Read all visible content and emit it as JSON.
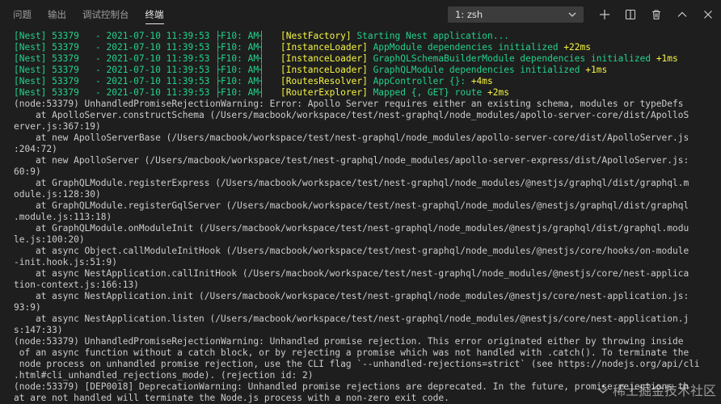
{
  "panel": {
    "tabs": [
      {
        "label": "问题"
      },
      {
        "label": "输出"
      },
      {
        "label": "调试控制台"
      },
      {
        "label": "终端"
      }
    ],
    "active_tab": "终端",
    "terminal_select": "1: zsh"
  },
  "colors": {
    "background": "#1e1e1e",
    "green": "#23d18b",
    "yellow": "#f5f543",
    "text": "#cccccc"
  },
  "icons": [
    "chevron-down-icon",
    "plus-icon",
    "split-icon",
    "trash-icon",
    "chevron-up-icon",
    "close-icon"
  ],
  "nest_logs": [
    {
      "prefix": "[Nest] 53379   - 2021-07-10 11:39:53 ├F10: AM┤   ",
      "context": "[NestFactory]",
      "message": " Starting Nest application...",
      "time": ""
    },
    {
      "prefix": "[Nest] 53379   - 2021-07-10 11:39:53 ├F10: AM┤   ",
      "context": "[InstanceLoader]",
      "message": " AppModule dependencies initialized ",
      "time": "+22ms"
    },
    {
      "prefix": "[Nest] 53379   - 2021-07-10 11:39:53 ├F10: AM┤   ",
      "context": "[InstanceLoader]",
      "message": " GraphQLSchemaBuilderModule dependencies initialized ",
      "time": "+1ms"
    },
    {
      "prefix": "[Nest] 53379   - 2021-07-10 11:39:53 ├F10: AM┤   ",
      "context": "[InstanceLoader]",
      "message": " GraphQLModule dependencies initialized ",
      "time": "+1ms"
    },
    {
      "prefix": "[Nest] 53379   - 2021-07-10 11:39:53 ├F10: AM┤   ",
      "context": "[RoutesResolver]",
      "message": " AppController {}: ",
      "time": "+4ms"
    },
    {
      "prefix": "[Nest] 53379   - 2021-07-10 11:39:53 ├F10: AM┤   ",
      "context": "[RouterExplorer]",
      "message": " Mapped {, GET} route ",
      "time": "+2ms"
    }
  ],
  "output_lines": [
    "(node:53379) UnhandledPromiseRejectionWarning: Error: Apollo Server requires either an existing schema, modules or typeDefs",
    "    at ApolloServer.constructSchema (/Users/macbook/workspace/test/nest-graphql/node_modules/apollo-server-core/dist/ApolloS",
    "erver.js:367:19)",
    "    at new ApolloServerBase (/Users/macbook/workspace/test/nest-graphql/node_modules/apollo-server-core/dist/ApolloServer.js",
    ":204:72)",
    "    at new ApolloServer (/Users/macbook/workspace/test/nest-graphql/node_modules/apollo-server-express/dist/ApolloServer.js:",
    "60:9)",
    "    at GraphQLModule.registerExpress (/Users/macbook/workspace/test/nest-graphql/node_modules/@nestjs/graphql/dist/graphql.m",
    "odule.js:128:30)",
    "    at GraphQLModule.registerGqlServer (/Users/macbook/workspace/test/nest-graphql/node_modules/@nestjs/graphql/dist/graphql",
    ".module.js:113:18)",
    "    at GraphQLModule.onModuleInit (/Users/macbook/workspace/test/nest-graphql/node_modules/@nestjs/graphql/dist/graphql.modu",
    "le.js:100:20)",
    "    at async Object.callModuleInitHook (/Users/macbook/workspace/test/nest-graphql/node_modules/@nestjs/core/hooks/on-module",
    "-init.hook.js:51:9)",
    "    at async NestApplication.callInitHook (/Users/macbook/workspace/test/nest-graphql/node_modules/@nestjs/core/nest-applica",
    "tion-context.js:166:13)",
    "    at async NestApplication.init (/Users/macbook/workspace/test/nest-graphql/node_modules/@nestjs/core/nest-application.js:",
    "93:9)",
    "    at async NestApplication.listen (/Users/macbook/workspace/test/nest-graphql/node_modules/@nestjs/core/nest-application.j",
    "s:147:33)",
    "(node:53379) UnhandledPromiseRejectionWarning: Unhandled promise rejection. This error originated either by throwing inside",
    " of an async function without a catch block, or by rejecting a promise which was not handled with .catch(). To terminate the",
    " node process on unhandled promise rejection, use the CLI flag `--unhandled-rejections=strict` (see https://nodejs.org/api/cli",
    ".html#cli_unhandled_rejections_mode). (rejection id: 2)",
    "(node:53379) [DEP0018] DeprecationWarning: Unhandled promise rejections are deprecated. In the future, promise rejections th",
    "at are not handled will terminate the Node.js process with a non-zero exit code."
  ],
  "watermark": "稀土掘金技术社区"
}
